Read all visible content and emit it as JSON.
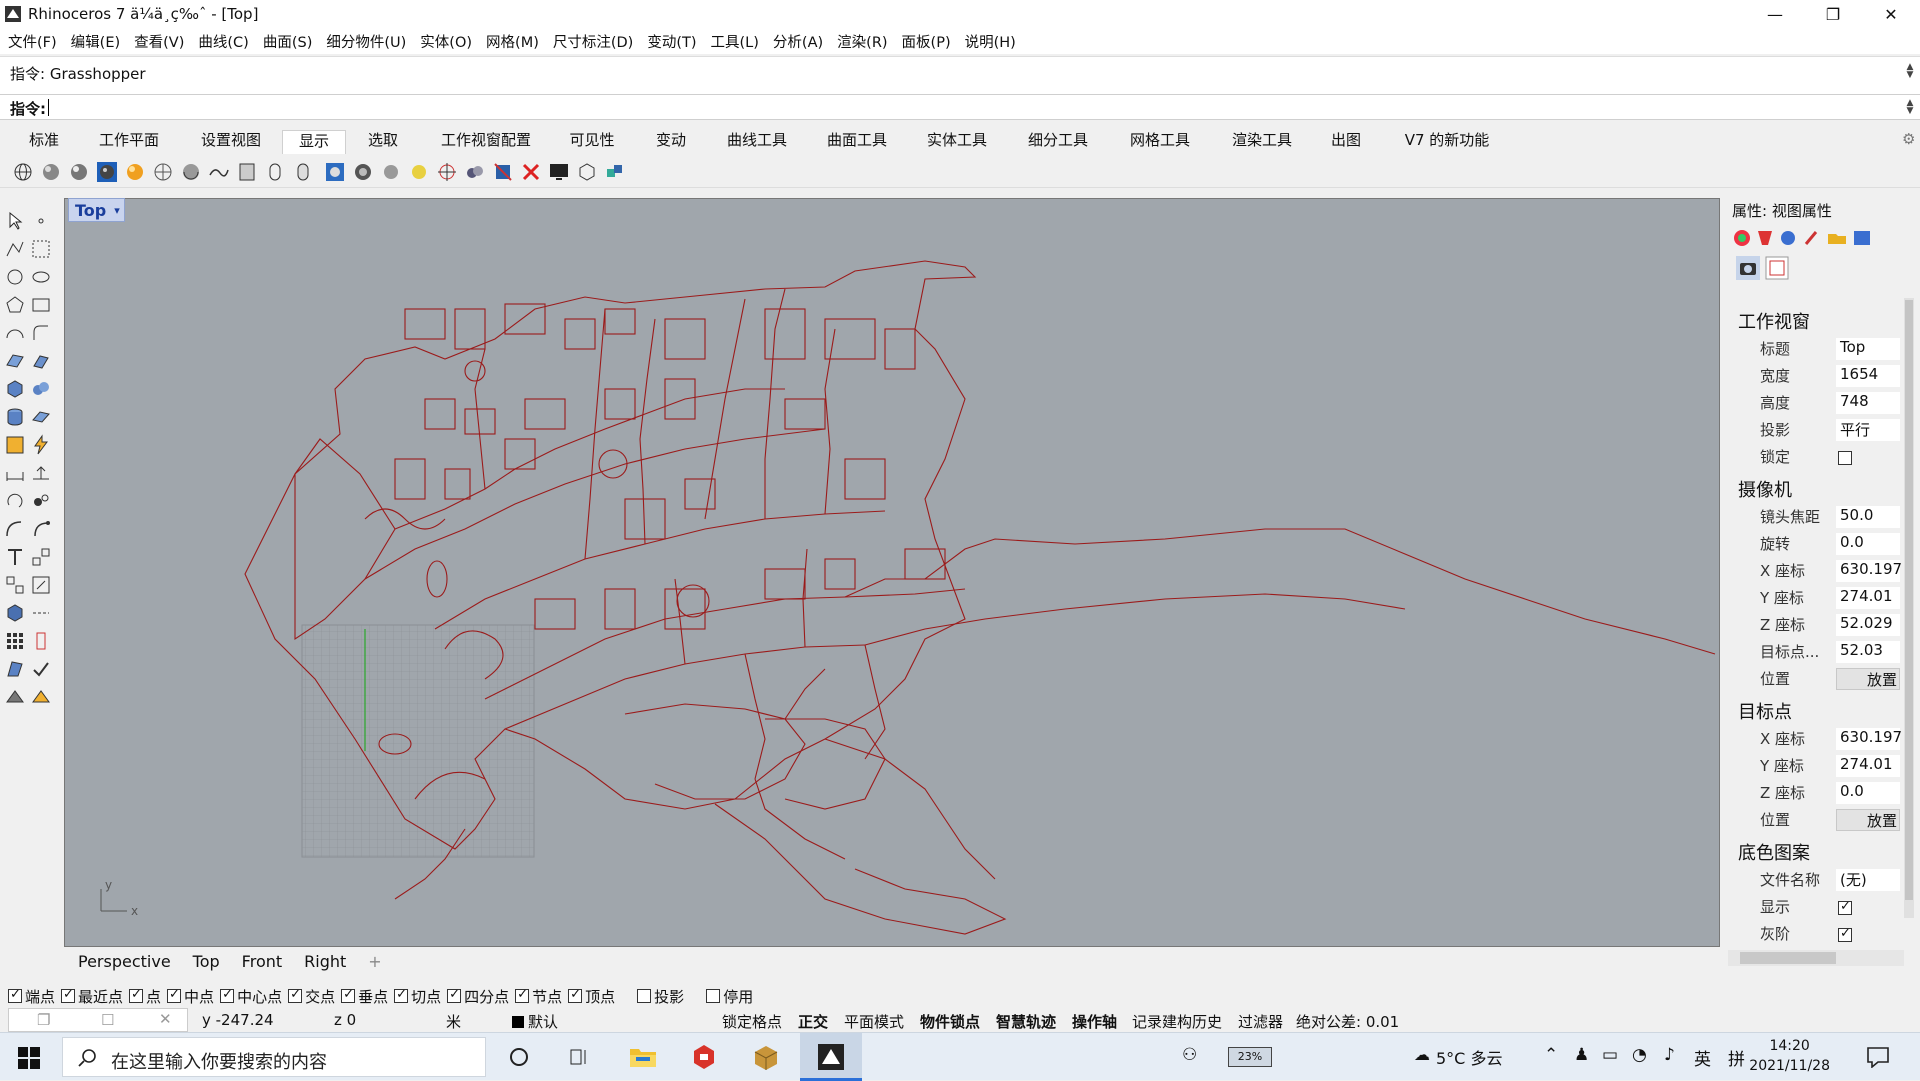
{
  "window": {
    "title": "Rhinoceros 7 ä¼ä¸ç‰ˆ - [Top]",
    "controls": [
      "—",
      "❐",
      "✕"
    ]
  },
  "menu": [
    "文件(F)",
    "编辑(E)",
    "查看(V)",
    "曲线(C)",
    "曲面(S)",
    "细分物件(U)",
    "实体(O)",
    "网格(M)",
    "尺寸标注(D)",
    "变动(T)",
    "工具(L)",
    "分析(A)",
    "渲染(R)",
    "面板(P)",
    "说明(H)"
  ],
  "command": {
    "history": "指令: Grasshopper",
    "prompt_label": "指令:"
  },
  "toolbar_tabs": [
    "标准",
    "工作平面",
    "设置视图",
    "显示",
    "选取",
    "工作视窗配置",
    "可见性",
    "变动",
    "曲线工具",
    "曲面工具",
    "实体工具",
    "细分工具",
    "网格工具",
    "渲染工具",
    "出图",
    "V7 的新功能"
  ],
  "active_tab": "显示",
  "viewport": {
    "name": "Top",
    "dropdown": "▾",
    "axis_x": "x",
    "axis_y": "y"
  },
  "viewport_tabs": [
    "Perspective",
    "Top",
    "Front",
    "Right",
    "+"
  ],
  "properties": {
    "header": "属性: 视图属性",
    "viewport_section": "工作视窗",
    "viewport_rows": [
      {
        "k": "标题",
        "v": "Top"
      },
      {
        "k": "宽度",
        "v": "1654"
      },
      {
        "k": "高度",
        "v": "748"
      },
      {
        "k": "投影",
        "v": "平行"
      },
      {
        "k": "锁定",
        "v": ""
      }
    ],
    "camera_section": "摄像机",
    "camera_rows": [
      {
        "k": "镜头焦距",
        "v": "50.0"
      },
      {
        "k": "旋转",
        "v": "0.0"
      },
      {
        "k": "X 座标",
        "v": "630.197"
      },
      {
        "k": "Y 座标",
        "v": "274.01"
      },
      {
        "k": "Z 座标",
        "v": "52.029"
      },
      {
        "k": "目标点...",
        "v": "52.03"
      },
      {
        "k": "位置",
        "v": "放置"
      }
    ],
    "target_section": "目标点",
    "target_rows": [
      {
        "k": "X 座标",
        "v": "630.197"
      },
      {
        "k": "Y 座标",
        "v": "274.01"
      },
      {
        "k": "Z 座标",
        "v": "0.0"
      },
      {
        "k": "位置",
        "v": "放置"
      }
    ],
    "wallpaper_section": "底色图案",
    "wallpaper_rows": [
      {
        "k": "文件名称",
        "v": "(无)"
      },
      {
        "k": "显示",
        "v": ""
      },
      {
        "k": "灰阶",
        "v": ""
      }
    ]
  },
  "osnap": [
    "端点",
    "最近点",
    "点",
    "中点",
    "中心点",
    "交点",
    "垂点",
    "切点",
    "四分点",
    "节点",
    "顶点",
    "投影",
    "停用"
  ],
  "status": {
    "y": "y -247.24",
    "z": "z 0",
    "unit": "米",
    "layer": "默认",
    "grid_snap": "锁定格点",
    "ortho": "正交",
    "planar": "平面模式",
    "osnap": "物件锁点",
    "smarttrack": "智慧轨迹",
    "gumball": "操作轴",
    "history": "记录建构历史",
    "filter": "过滤器",
    "tolerance": "绝对公差: 0.01"
  },
  "taskbar": {
    "search_placeholder": "在这里输入你要搜索的内容",
    "battery": "23%",
    "weather": "5°C 多云",
    "ime": "英",
    "ime2": "拼",
    "time": "14:20",
    "date": "2021/11/28"
  }
}
